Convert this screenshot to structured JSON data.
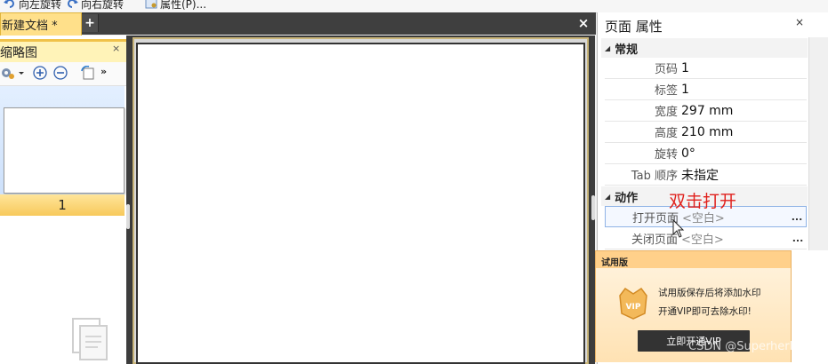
{
  "toolbar": {
    "items": [
      {
        "label": "向左旋转",
        "icon": "rotate-left-icon"
      },
      {
        "label": "向右旋转",
        "icon": "rotate-right-icon"
      },
      {
        "label": "属性(P)...",
        "icon": "properties-icon"
      }
    ]
  },
  "document": {
    "tab_label": "新建文档 *",
    "add_tab": "+",
    "close": "×"
  },
  "thumbnails": {
    "title": "缩略图",
    "close": "×",
    "tools": [
      "settings-icon",
      "zoom-in-icon",
      "zoom-out-icon",
      "rotate-90-icon",
      "more-icon"
    ],
    "more_glyph": "»",
    "page_number": "1"
  },
  "properties": {
    "title": "页面 属性",
    "close": "×",
    "sections": [
      {
        "name": "常规",
        "rows": [
          {
            "label": "页码",
            "value": "1"
          },
          {
            "label": "标签",
            "value": "1"
          },
          {
            "label": "宽度",
            "value": "297 mm"
          },
          {
            "label": "高度",
            "value": "210 mm"
          },
          {
            "label": "旋转",
            "value": "0°"
          },
          {
            "label": "Tab 顺序",
            "value": "未指定"
          }
        ]
      },
      {
        "name": "动作",
        "rows": [
          {
            "label": "打开页面",
            "value": "<空白>",
            "button": "..."
          },
          {
            "label": "关闭页面",
            "value": "<空白>",
            "button": "..."
          }
        ]
      }
    ],
    "annotation": "双击打开"
  },
  "trial": {
    "title": "试用版",
    "line1": "试用版保存后将添加水印",
    "line2": "开通VIP即可去除水印!",
    "button": "立即开通VIP",
    "badge": "VIP"
  },
  "watermark": "CSDN @SuperherRo",
  "colors": {
    "tab_active": "#ffe08a",
    "thumb_selected": "#f7c95b",
    "annotation": "#e0201c",
    "trial_bg": "#ffd08a"
  }
}
